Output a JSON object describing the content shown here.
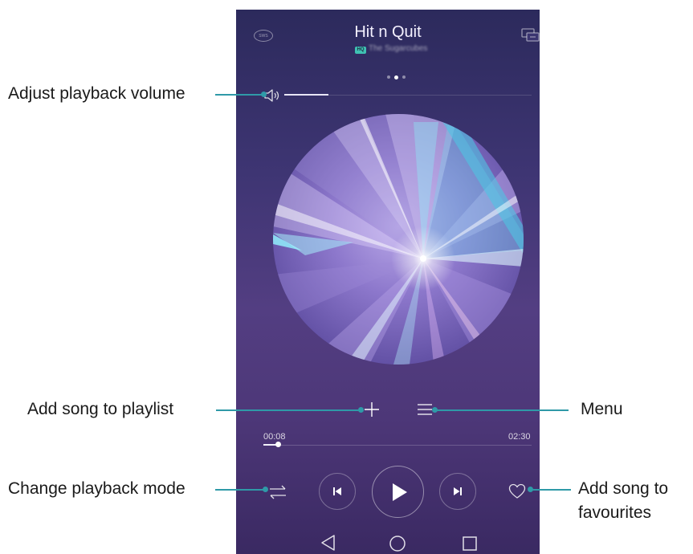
{
  "player": {
    "song_title": "Hit n Quit",
    "quality_badge": "HQ",
    "artist": "The Sugarcubes",
    "sws_icon_label": "SWS",
    "current_time": "00:08",
    "total_time": "02:30",
    "progress_fraction": 0.053,
    "volume_fraction": 0.18
  },
  "callouts": {
    "volume": "Adjust playback volume",
    "add_to_playlist": "Add song to playlist",
    "change_mode": "Change playback mode",
    "menu": "Menu",
    "favourites_line1": "Add song to",
    "favourites_line2": "favourites"
  },
  "colors": {
    "leader_line": "#2f9aa8",
    "hq_badge": "#3fc2b3",
    "background_top": "#2c2a5c",
    "background_bottom": "#3a2962"
  },
  "icons": {
    "sound_effects": "sws-icon",
    "screen_cast": "screen-cast-icon",
    "volume": "speaker-icon",
    "add": "plus-icon",
    "menu": "menu-lines-icon",
    "mode": "repeat-order-icon",
    "previous": "skip-previous-icon",
    "play": "play-icon",
    "next": "skip-next-icon",
    "favourite": "heart-icon",
    "back": "nav-back-icon",
    "home": "nav-home-icon",
    "recents": "nav-recents-icon"
  }
}
